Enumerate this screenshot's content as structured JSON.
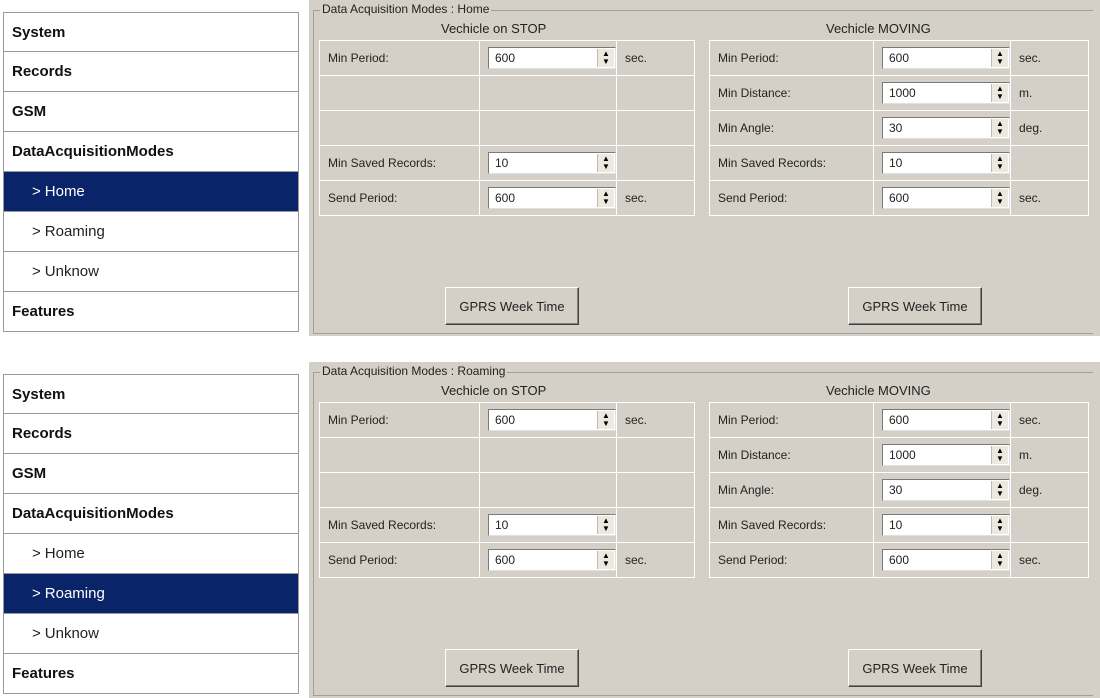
{
  "nav": {
    "system": "System",
    "records": "Records",
    "gsm": "GSM",
    "dam": "DataAcquisitionModes",
    "home": "Home",
    "roaming": "Roaming",
    "unknow": "Unknow",
    "features": "Features",
    "arrow": ">"
  },
  "panels": [
    {
      "selected": "Home",
      "legend": "Data Acquisition Modes : Home",
      "stop": {
        "title": "Vechicle on STOP",
        "min_period_label": "Min Period:",
        "min_period": "600",
        "min_period_unit": "sec.",
        "min_saved_label": "Min Saved Records:",
        "min_saved": "10",
        "send_period_label": "Send Period:",
        "send_period": "600",
        "send_period_unit": "sec."
      },
      "moving": {
        "title": "Vechicle MOVING",
        "min_period_label": "Min Period:",
        "min_period": "600",
        "min_period_unit": "sec.",
        "min_distance_label": "Min Distance:",
        "min_distance": "1000",
        "min_distance_unit": "m.",
        "min_angle_label": "Min Angle:",
        "min_angle": "30",
        "min_angle_unit": "deg.",
        "min_saved_label": "Min Saved Records:",
        "min_saved": "10",
        "send_period_label": "Send Period:",
        "send_period": "600",
        "send_period_unit": "sec."
      },
      "gprs_button": "GPRS Week Time"
    },
    {
      "selected": "Roaming",
      "legend": "Data Acquisition Modes : Roaming",
      "stop": {
        "title": "Vechicle on STOP",
        "min_period_label": "Min Period:",
        "min_period": "600",
        "min_period_unit": "sec.",
        "min_saved_label": "Min Saved Records:",
        "min_saved": "10",
        "send_period_label": "Send Period:",
        "send_period": "600",
        "send_period_unit": "sec."
      },
      "moving": {
        "title": "Vechicle MOVING",
        "min_period_label": "Min Period:",
        "min_period": "600",
        "min_period_unit": "sec.",
        "min_distance_label": "Min Distance:",
        "min_distance": "1000",
        "min_distance_unit": "m.",
        "min_angle_label": "Min Angle:",
        "min_angle": "30",
        "min_angle_unit": "deg.",
        "min_saved_label": "Min Saved Records:",
        "min_saved": "10",
        "send_period_label": "Send Period:",
        "send_period": "600",
        "send_period_unit": "sec."
      },
      "gprs_button": "GPRS Week Time"
    }
  ],
  "colors": {
    "selected_bg": "#0a246a",
    "panel_bg": "#d4d0c8"
  }
}
